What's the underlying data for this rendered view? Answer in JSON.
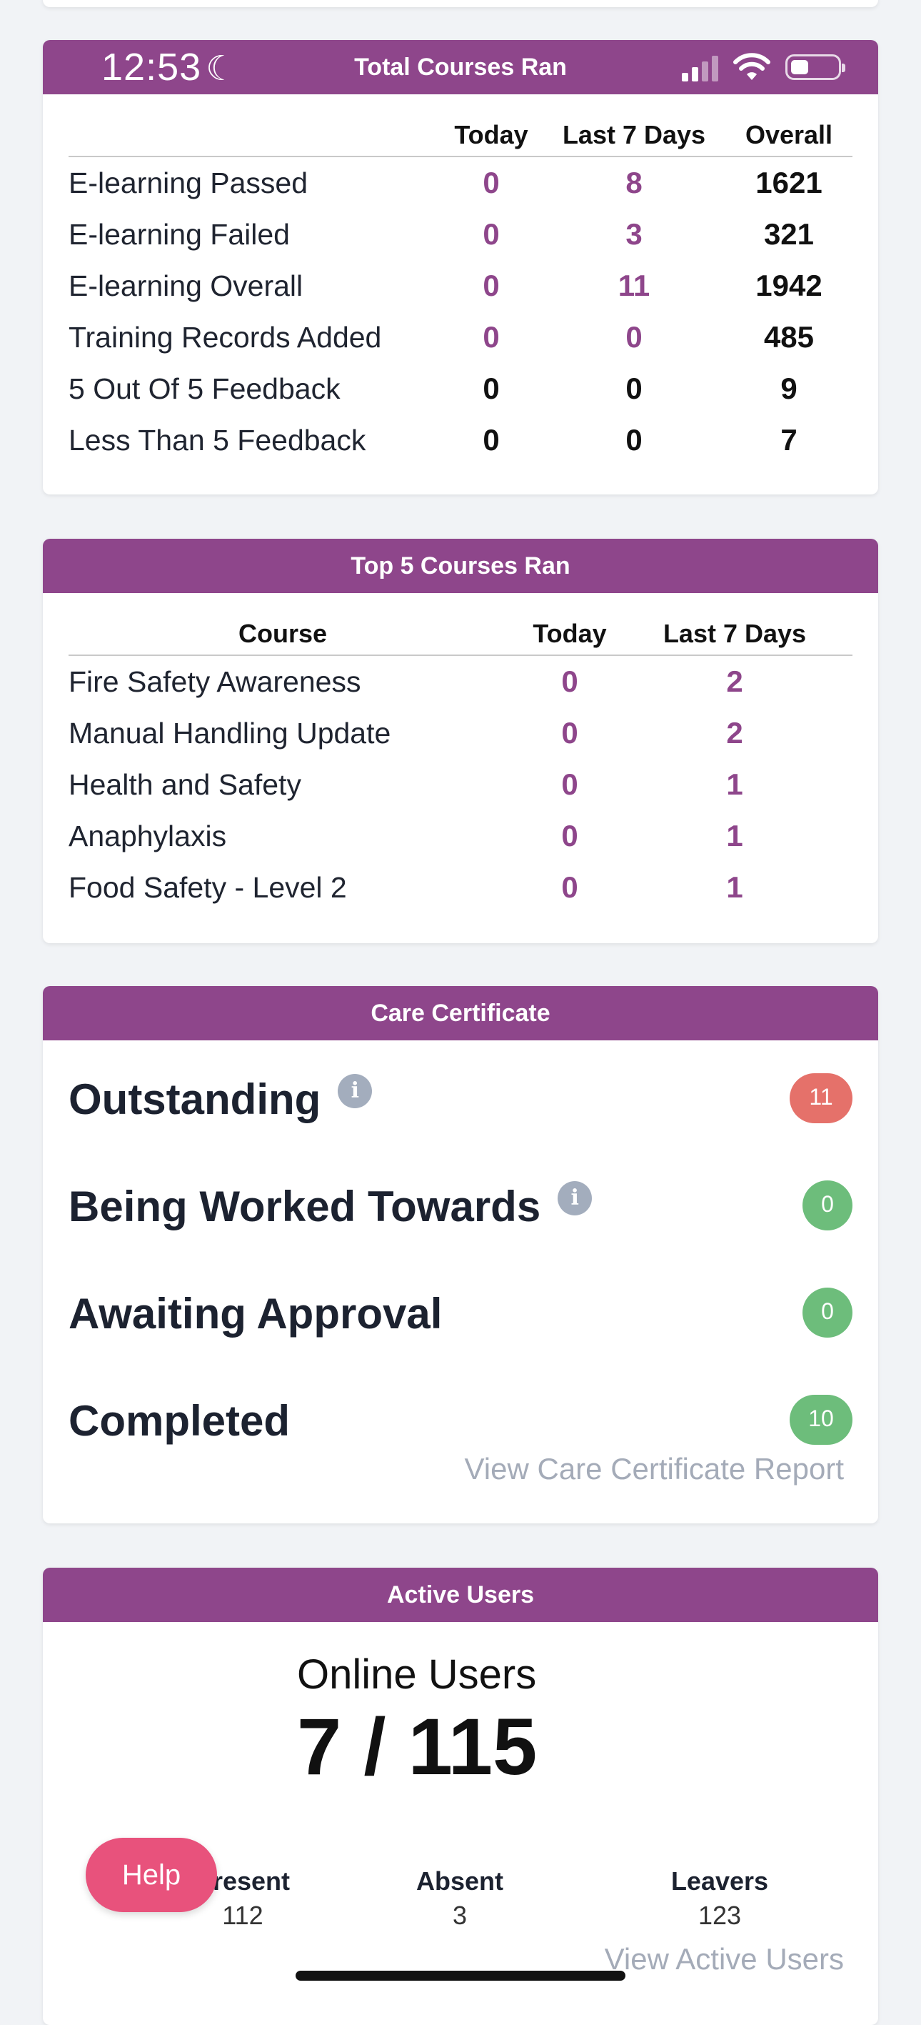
{
  "status_bar": {
    "time": "12:53"
  },
  "total_courses": {
    "title": "Total Courses Ran",
    "columns": [
      "Today",
      "Last 7 Days",
      "Overall"
    ],
    "rows": [
      {
        "label": "E-learning Passed",
        "today": "0",
        "last7": "8",
        "overall": "1621"
      },
      {
        "label": "E-learning Failed",
        "today": "0",
        "last7": "3",
        "overall": "321"
      },
      {
        "label": "E-learning Overall",
        "today": "0",
        "last7": "11",
        "overall": "1942"
      },
      {
        "label": "Training Records Added",
        "today": "0",
        "last7": "0",
        "overall": "485"
      },
      {
        "label": "5 Out Of 5 Feedback",
        "today": "0",
        "last7": "0",
        "overall": "9"
      },
      {
        "label": "Less Than 5 Feedback",
        "today": "0",
        "last7": "0",
        "overall": "7"
      }
    ]
  },
  "top_courses": {
    "title": "Top 5 Courses Ran",
    "columns": [
      "Course",
      "Today",
      "Last 7 Days"
    ],
    "rows": [
      {
        "label": "Fire Safety Awareness",
        "today": "0",
        "last7": "2"
      },
      {
        "label": "Manual Handling Update",
        "today": "0",
        "last7": "2"
      },
      {
        "label": "Health and Safety",
        "today": "0",
        "last7": "1"
      },
      {
        "label": "Anaphylaxis",
        "today": "0",
        "last7": "1"
      },
      {
        "label": "Food Safety - Level 2",
        "today": "0",
        "last7": "1"
      }
    ]
  },
  "care_certificate": {
    "title": "Care Certificate",
    "items": [
      {
        "label": "Outstanding",
        "count": "11",
        "color": "#e5716a"
      },
      {
        "label": "Being Worked Towards",
        "count": "0",
        "color": "#6dbd7b"
      },
      {
        "label": "Awaiting Approval",
        "count": "0",
        "color": "#6dbd7b"
      },
      {
        "label": "Completed",
        "count": "10",
        "color": "#6dbd7b"
      }
    ],
    "report_link": "View Care Certificate Report"
  },
  "active_users": {
    "title": "Active Users",
    "online_label": "Online Users",
    "online_count": "7 / 115",
    "columns": [
      {
        "label": "Present",
        "value": "112"
      },
      {
        "label": "Absent",
        "value": "3"
      },
      {
        "label": "Leavers",
        "value": "123"
      }
    ],
    "link": "View Active Users"
  },
  "help_button": "Help",
  "colors": {
    "header": "#8e468b",
    "accent_text": "#8e468b",
    "help": "#e8527c"
  }
}
